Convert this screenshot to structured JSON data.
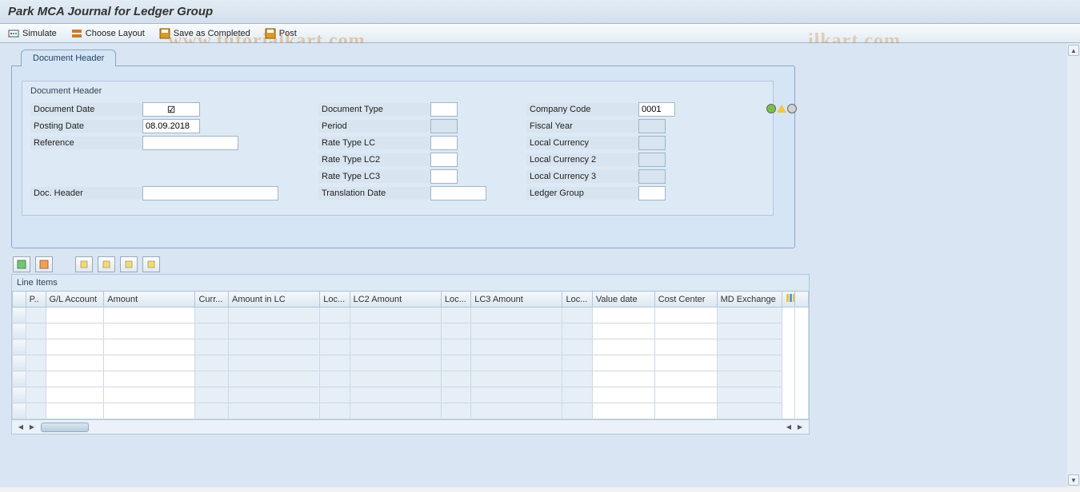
{
  "title": "Park MCA Journal for Ledger Group",
  "toolbar": {
    "simulate": "Simulate",
    "choose_layout": "Choose Layout",
    "save_completed": "Save as Completed",
    "post": "Post"
  },
  "tab1": "Document Header",
  "group_title": "Document Header",
  "fields": {
    "document_date_lbl": "Document Date",
    "document_date_val": "",
    "posting_date_lbl": "Posting Date",
    "posting_date_val": "08.09.2018",
    "reference_lbl": "Reference",
    "reference_val": "",
    "doc_header_lbl": "Doc. Header",
    "doc_header_val": "",
    "document_type_lbl": "Document Type",
    "document_type_val": "",
    "period_lbl": "Period",
    "period_val": "",
    "rate_lc_lbl": "Rate Type LC",
    "rate_lc_val": "",
    "rate_lc2_lbl": "Rate Type LC2",
    "rate_lc2_val": "",
    "rate_lc3_lbl": "Rate Type LC3",
    "rate_lc3_val": "",
    "translation_date_lbl": "Translation Date",
    "translation_date_val": "",
    "company_code_lbl": "Company Code",
    "company_code_val": "0001",
    "fiscal_year_lbl": "Fiscal Year",
    "fiscal_year_val": "",
    "local_currency_lbl": "Local Currency",
    "local_currency_val": "",
    "local_currency2_lbl": "Local Currency 2",
    "local_currency2_val": "",
    "local_currency3_lbl": "Local Currency 3",
    "local_currency3_val": "",
    "ledger_group_lbl": "Ledger Group",
    "ledger_group_val": ""
  },
  "traffic_colors": {
    "green": "#7cc04a",
    "yellow": "#f2c73d",
    "gray": "#d0d0d0"
  },
  "line_items_title": "Line Items",
  "columns": {
    "c0": "P..",
    "c1": "G/L Account",
    "c2": "Amount",
    "c3": "Curr...",
    "c4": "Amount in LC",
    "c5": "Loc...",
    "c6": "LC2 Amount",
    "c7": "Loc...",
    "c8": "LC3 Amount",
    "c9": "Loc...",
    "c10": "Value date",
    "c11": "Cost Center",
    "c12": "MD Exchange"
  },
  "watermark_a": "www.tutorialkart.com",
  "watermark_b": "ilkart.com"
}
